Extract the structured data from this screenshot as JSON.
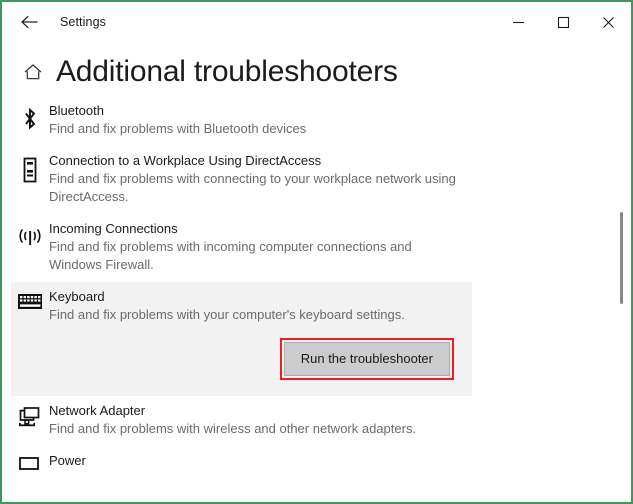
{
  "window": {
    "app_title": "Settings",
    "accent_border_color": "#3a9a5c",
    "back_icon": "back-arrow-icon",
    "minimize_label": "Minimize",
    "maximize_label": "Maximize",
    "close_label": "Close"
  },
  "header": {
    "home_icon": "home-icon",
    "title": "Additional troubleshooters"
  },
  "list": {
    "items": [
      {
        "icon": "bluetooth-icon",
        "title": "Bluetooth",
        "description": "Find and fix problems with Bluetooth devices",
        "selected": false
      },
      {
        "icon": "workplace-device-icon",
        "title": "Connection to a Workplace Using DirectAccess",
        "description": "Find and fix problems with connecting to your workplace network using DirectAccess.",
        "selected": false
      },
      {
        "icon": "antenna-broadcast-icon",
        "title": "Incoming Connections",
        "description": "Find and fix problems with incoming computer connections and Windows Firewall.",
        "selected": false
      },
      {
        "icon": "keyboard-icon",
        "title": "Keyboard",
        "description": "Find and fix problems with your computer's keyboard settings.",
        "selected": true,
        "action_label": "Run the troubleshooter",
        "action_highlight_color": "#ee1c25"
      },
      {
        "icon": "network-adapter-icon",
        "title": "Network Adapter",
        "description": "Find and fix problems with wireless and other network adapters.",
        "selected": false
      },
      {
        "icon": "power-icon",
        "title": "Power",
        "description": "",
        "selected": false
      }
    ]
  },
  "scrollbar": {
    "name": "vertical-scrollbar",
    "thumb_color": "#888888"
  }
}
